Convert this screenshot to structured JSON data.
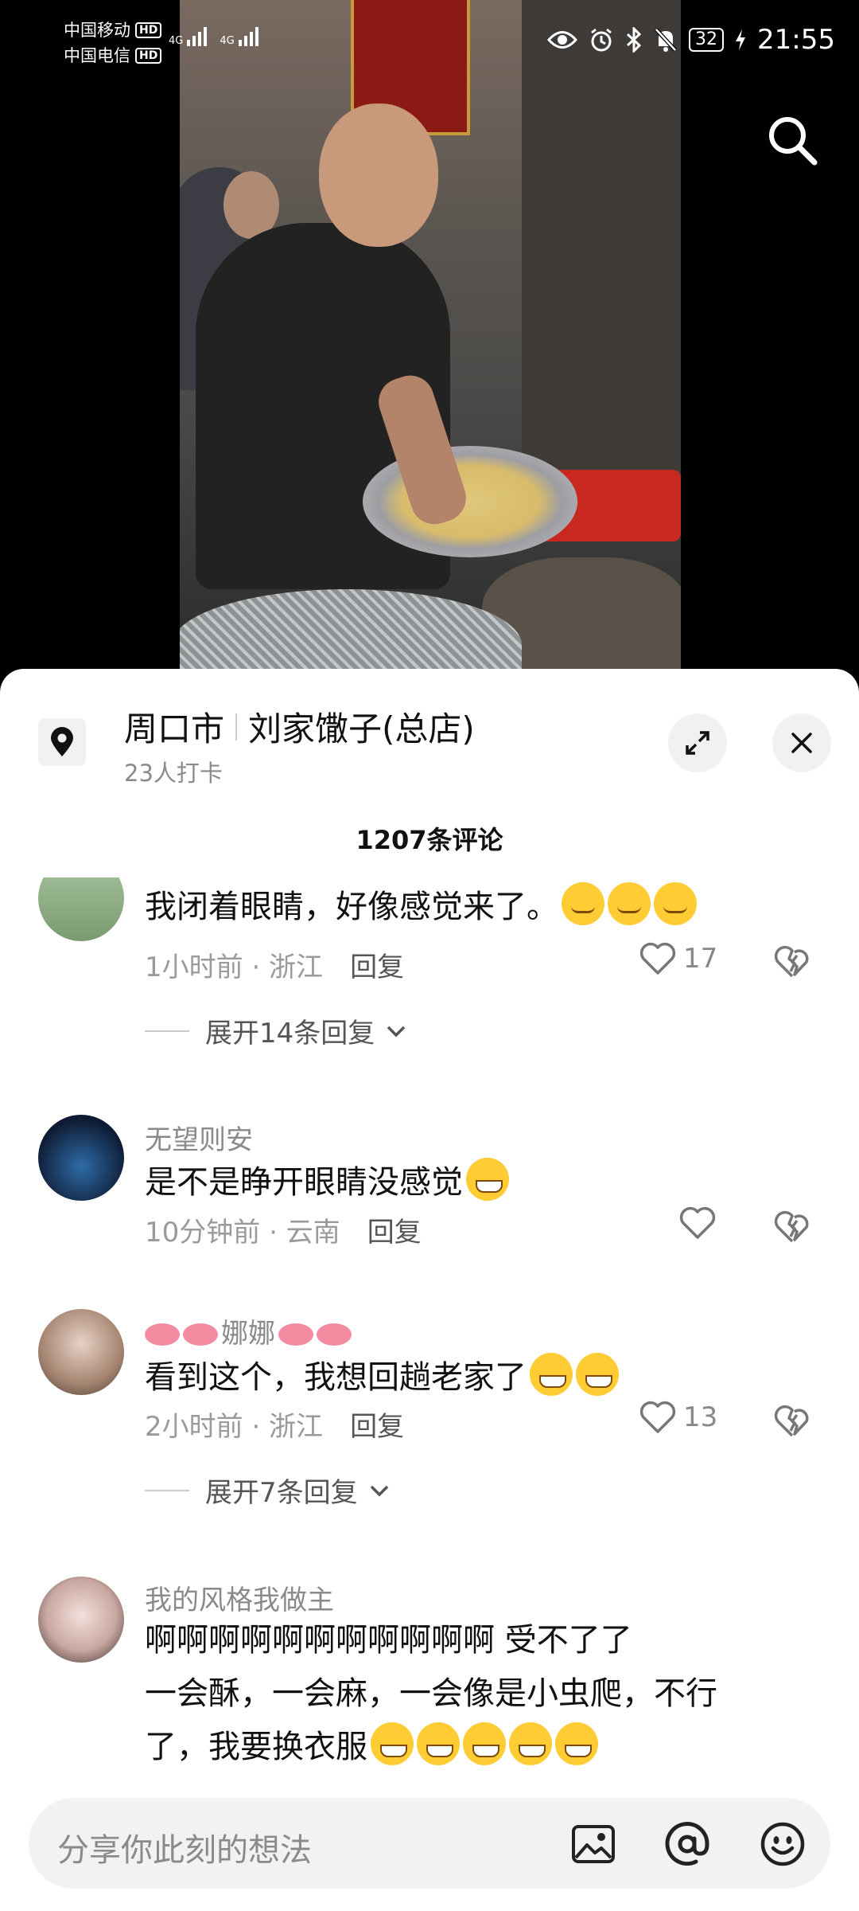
{
  "status_bar": {
    "carrier_1": "中国移动",
    "carrier_2": "中国电信",
    "hd": "HD",
    "network": "4G",
    "battery": "32",
    "time": "21:55"
  },
  "location": {
    "city": "周口市",
    "shop": "刘家馓子(总店)",
    "checkins": "23人打卡"
  },
  "comment_count": "1207条评论",
  "comments": [
    {
      "text": "我闭着眼睛，好像感觉来了。",
      "time_location": "1小时前 · 浙江",
      "reply_label": "回复",
      "likes": "17",
      "expand": "展开14条回复"
    },
    {
      "user": "无望则安",
      "text": "是不是睁开眼睛没感觉",
      "time_location": "10分钟前 · 云南",
      "reply_label": "回复",
      "likes": ""
    },
    {
      "user": "娜娜",
      "text": "看到这个，我想回趟老家了",
      "time_location": "2小时前 · 浙江",
      "reply_label": "回复",
      "likes": "13",
      "expand": "展开7条回复"
    },
    {
      "user": "我的风格我做主",
      "text_line1": "啊啊啊啊啊啊啊啊啊啊啊 受不了了",
      "text_line2": "一会酥，一会麻，一会像是小虫爬，不行",
      "text_line3": "了，我要换衣服"
    }
  ],
  "input": {
    "placeholder": "分享你此刻的想法"
  },
  "icons": {
    "search": "search-icon",
    "location": "location-pin-icon",
    "expand": "expand-icon",
    "close": "close-icon",
    "like": "heart-icon",
    "dislike": "broken-heart-icon",
    "chevron": "chevron-down-icon",
    "image": "image-icon",
    "mention": "at-icon",
    "emoji": "emoji-icon"
  },
  "colors": {
    "sheet_bg": "#ffffff",
    "text_primary": "#111111",
    "text_secondary": "#8a8a8a"
  }
}
